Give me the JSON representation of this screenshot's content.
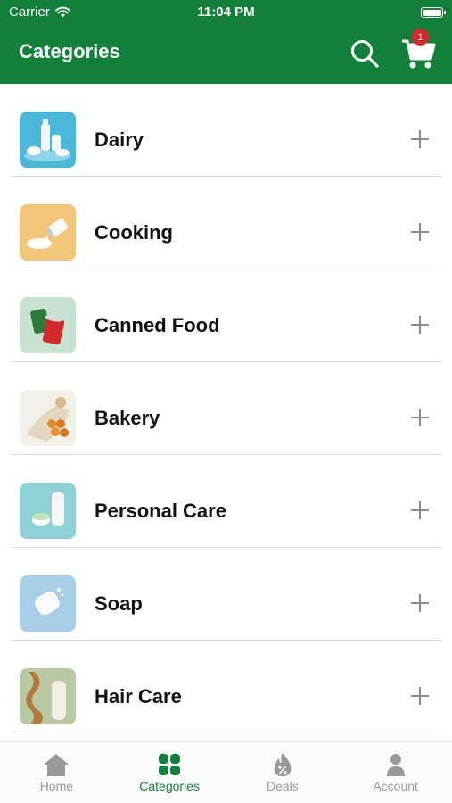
{
  "status_bar": {
    "carrier": "Carrier",
    "time": "11:04 PM"
  },
  "header": {
    "title": "Categories",
    "cart_count": "1"
  },
  "categories": [
    {
      "label": "Dairy"
    },
    {
      "label": "Cooking"
    },
    {
      "label": "Canned Food"
    },
    {
      "label": "Bakery"
    },
    {
      "label": "Personal Care"
    },
    {
      "label": "Soap"
    },
    {
      "label": "Hair Care"
    }
  ],
  "tabbar": {
    "items": [
      {
        "label": "Home",
        "icon": "home-icon"
      },
      {
        "label": "Categories",
        "icon": "grid-icon",
        "active": true
      },
      {
        "label": "Deals",
        "icon": "deals-icon"
      },
      {
        "label": "Account",
        "icon": "account-icon"
      }
    ]
  },
  "colors": {
    "brand": "#12803a",
    "badge": "#d6262e",
    "inactive": "#999999"
  }
}
